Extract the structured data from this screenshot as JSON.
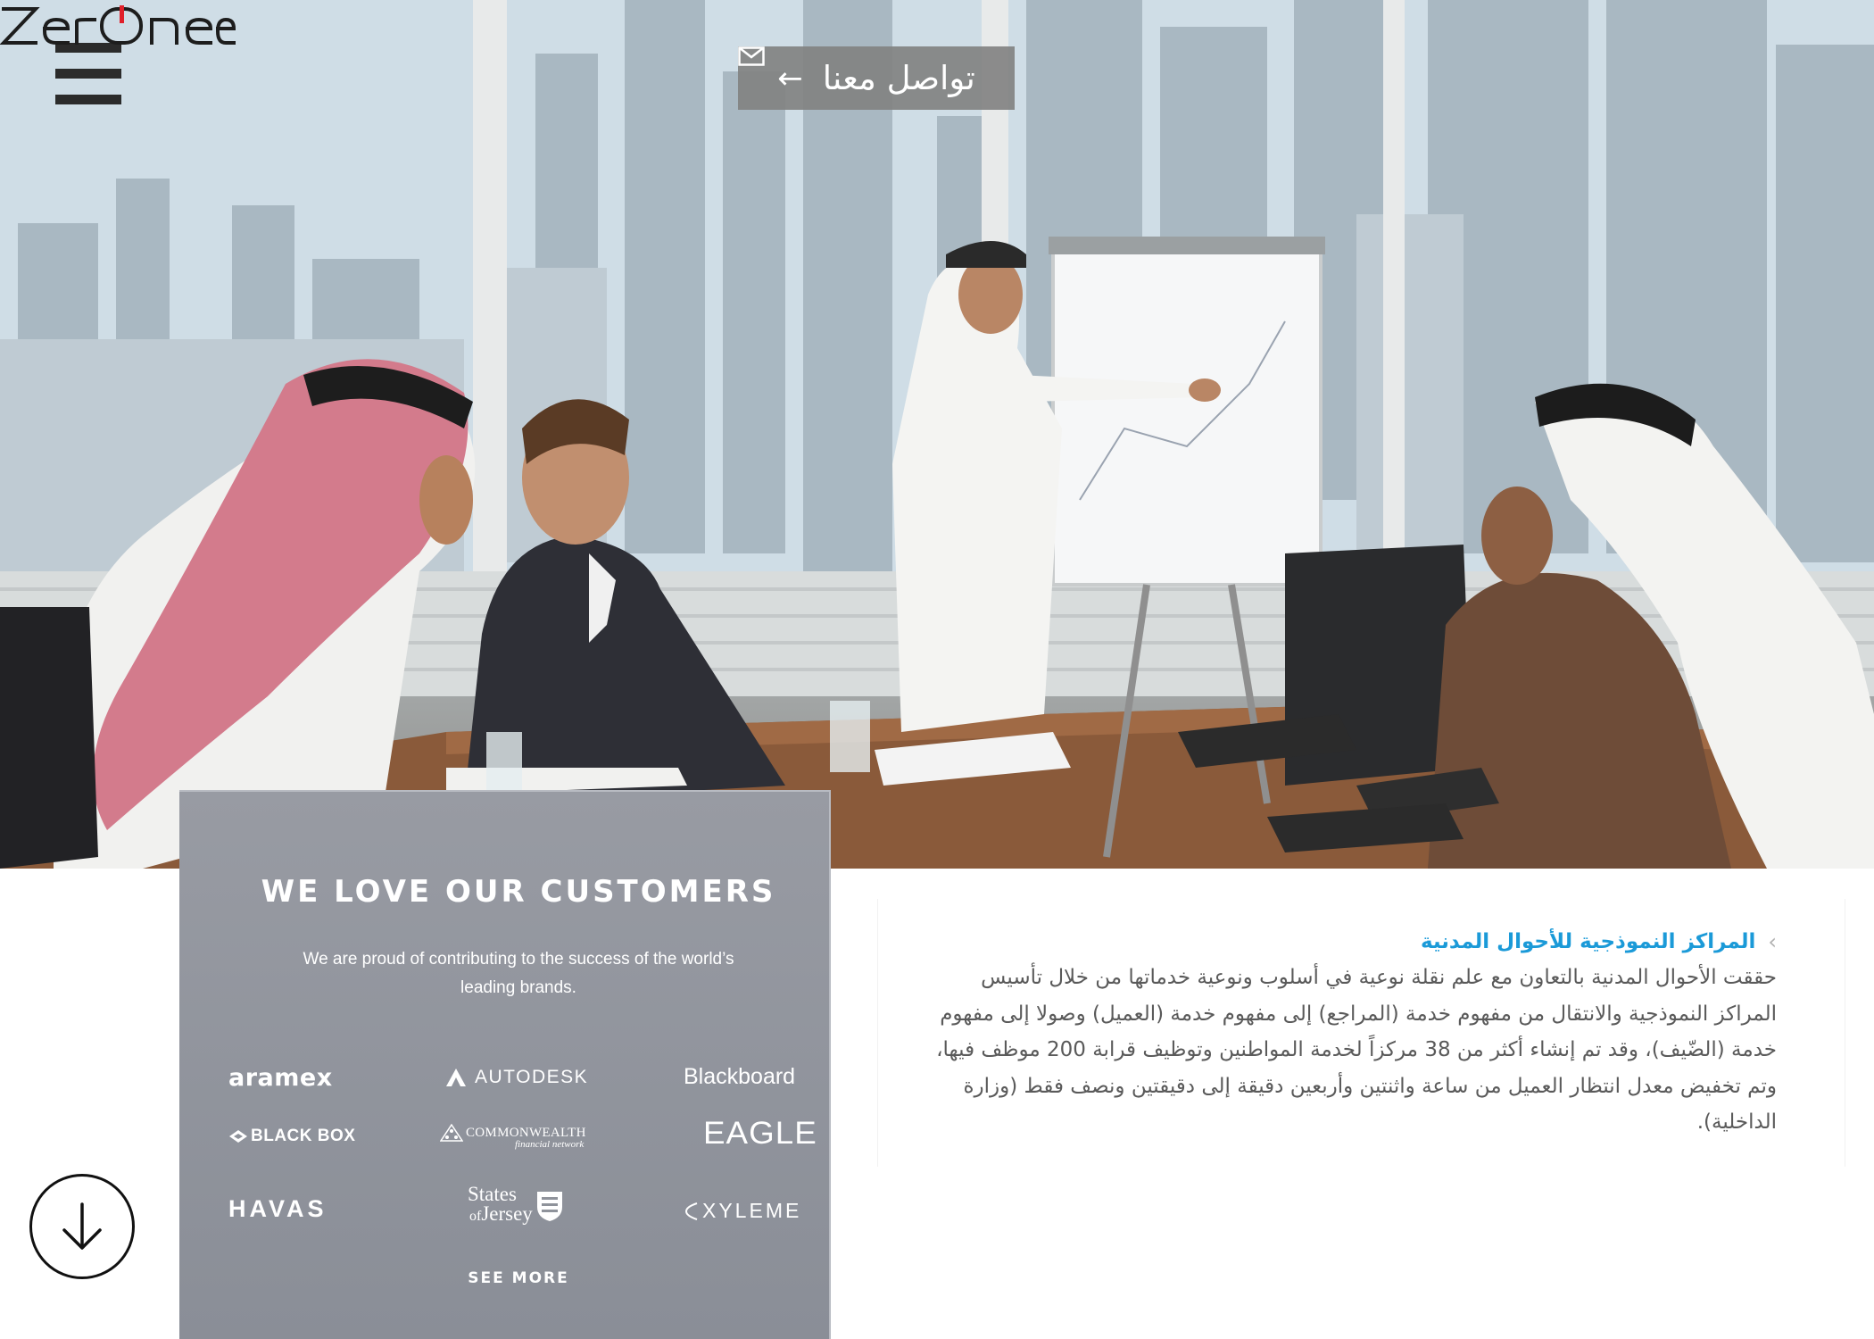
{
  "nav": {
    "menu_icon": "hamburger-menu-icon",
    "contact_label": "تواصل معنا",
    "contact_arrow_icon": "arrow-left-icon",
    "contact_mail_icon": "mail-icon",
    "logo_text": "ZerOne",
    "logo_accent_color": "#e0202a"
  },
  "hero": {
    "image": "business-meeting-photo"
  },
  "customers": {
    "title": "WE LOVE OUR CUSTOMERS",
    "subtitle": "We are proud of contributing to the success of the world’s leading brands.",
    "brands": {
      "aramex": "aramex",
      "autodesk": "AUTODESK",
      "blackboard": "Blackboard",
      "blackbox": "BLACK BOX",
      "commonwealth": "COMMONWEALTH",
      "commonwealth_sub": "financial network",
      "eagle": "EAGLE",
      "havas": "HAVAS",
      "jersey_line1": "States",
      "jersey_of": "of",
      "jersey_line2": "Jersey",
      "xyleme": "XYLEME"
    },
    "see_more": "SEE MORE",
    "panel_color": "#8f939b"
  },
  "article": {
    "title": "المراكز النموذجية للأحوال المدنية",
    "title_color": "#1b9ad8",
    "body": "حققت الأحوال المدنية بالتعاون مع علم نقلة نوعية في أسلوب ونوعية خدماتها من خلال تأسيس المراكز النموذجية والانتقال من مفهوم خدمة (المراجع) إلى مفهوم خدمة (العميل) وصولا إلى مفهوم خدمة (الضّيف)، وقد تم إنشاء أكثر من 38 مركزاً لخدمة المواطنين وتوظيف قرابة 200 موظف فيها، وتم تخفيض معدل انتظار العميل من ساعة واثنتين وأربعين دقيقة إلى دقيقتين ونصف فقط (وزارة الداخلية).",
    "chevron_icon": "chevron-left-icon"
  },
  "scroll": {
    "icon": "arrow-down-icon"
  }
}
